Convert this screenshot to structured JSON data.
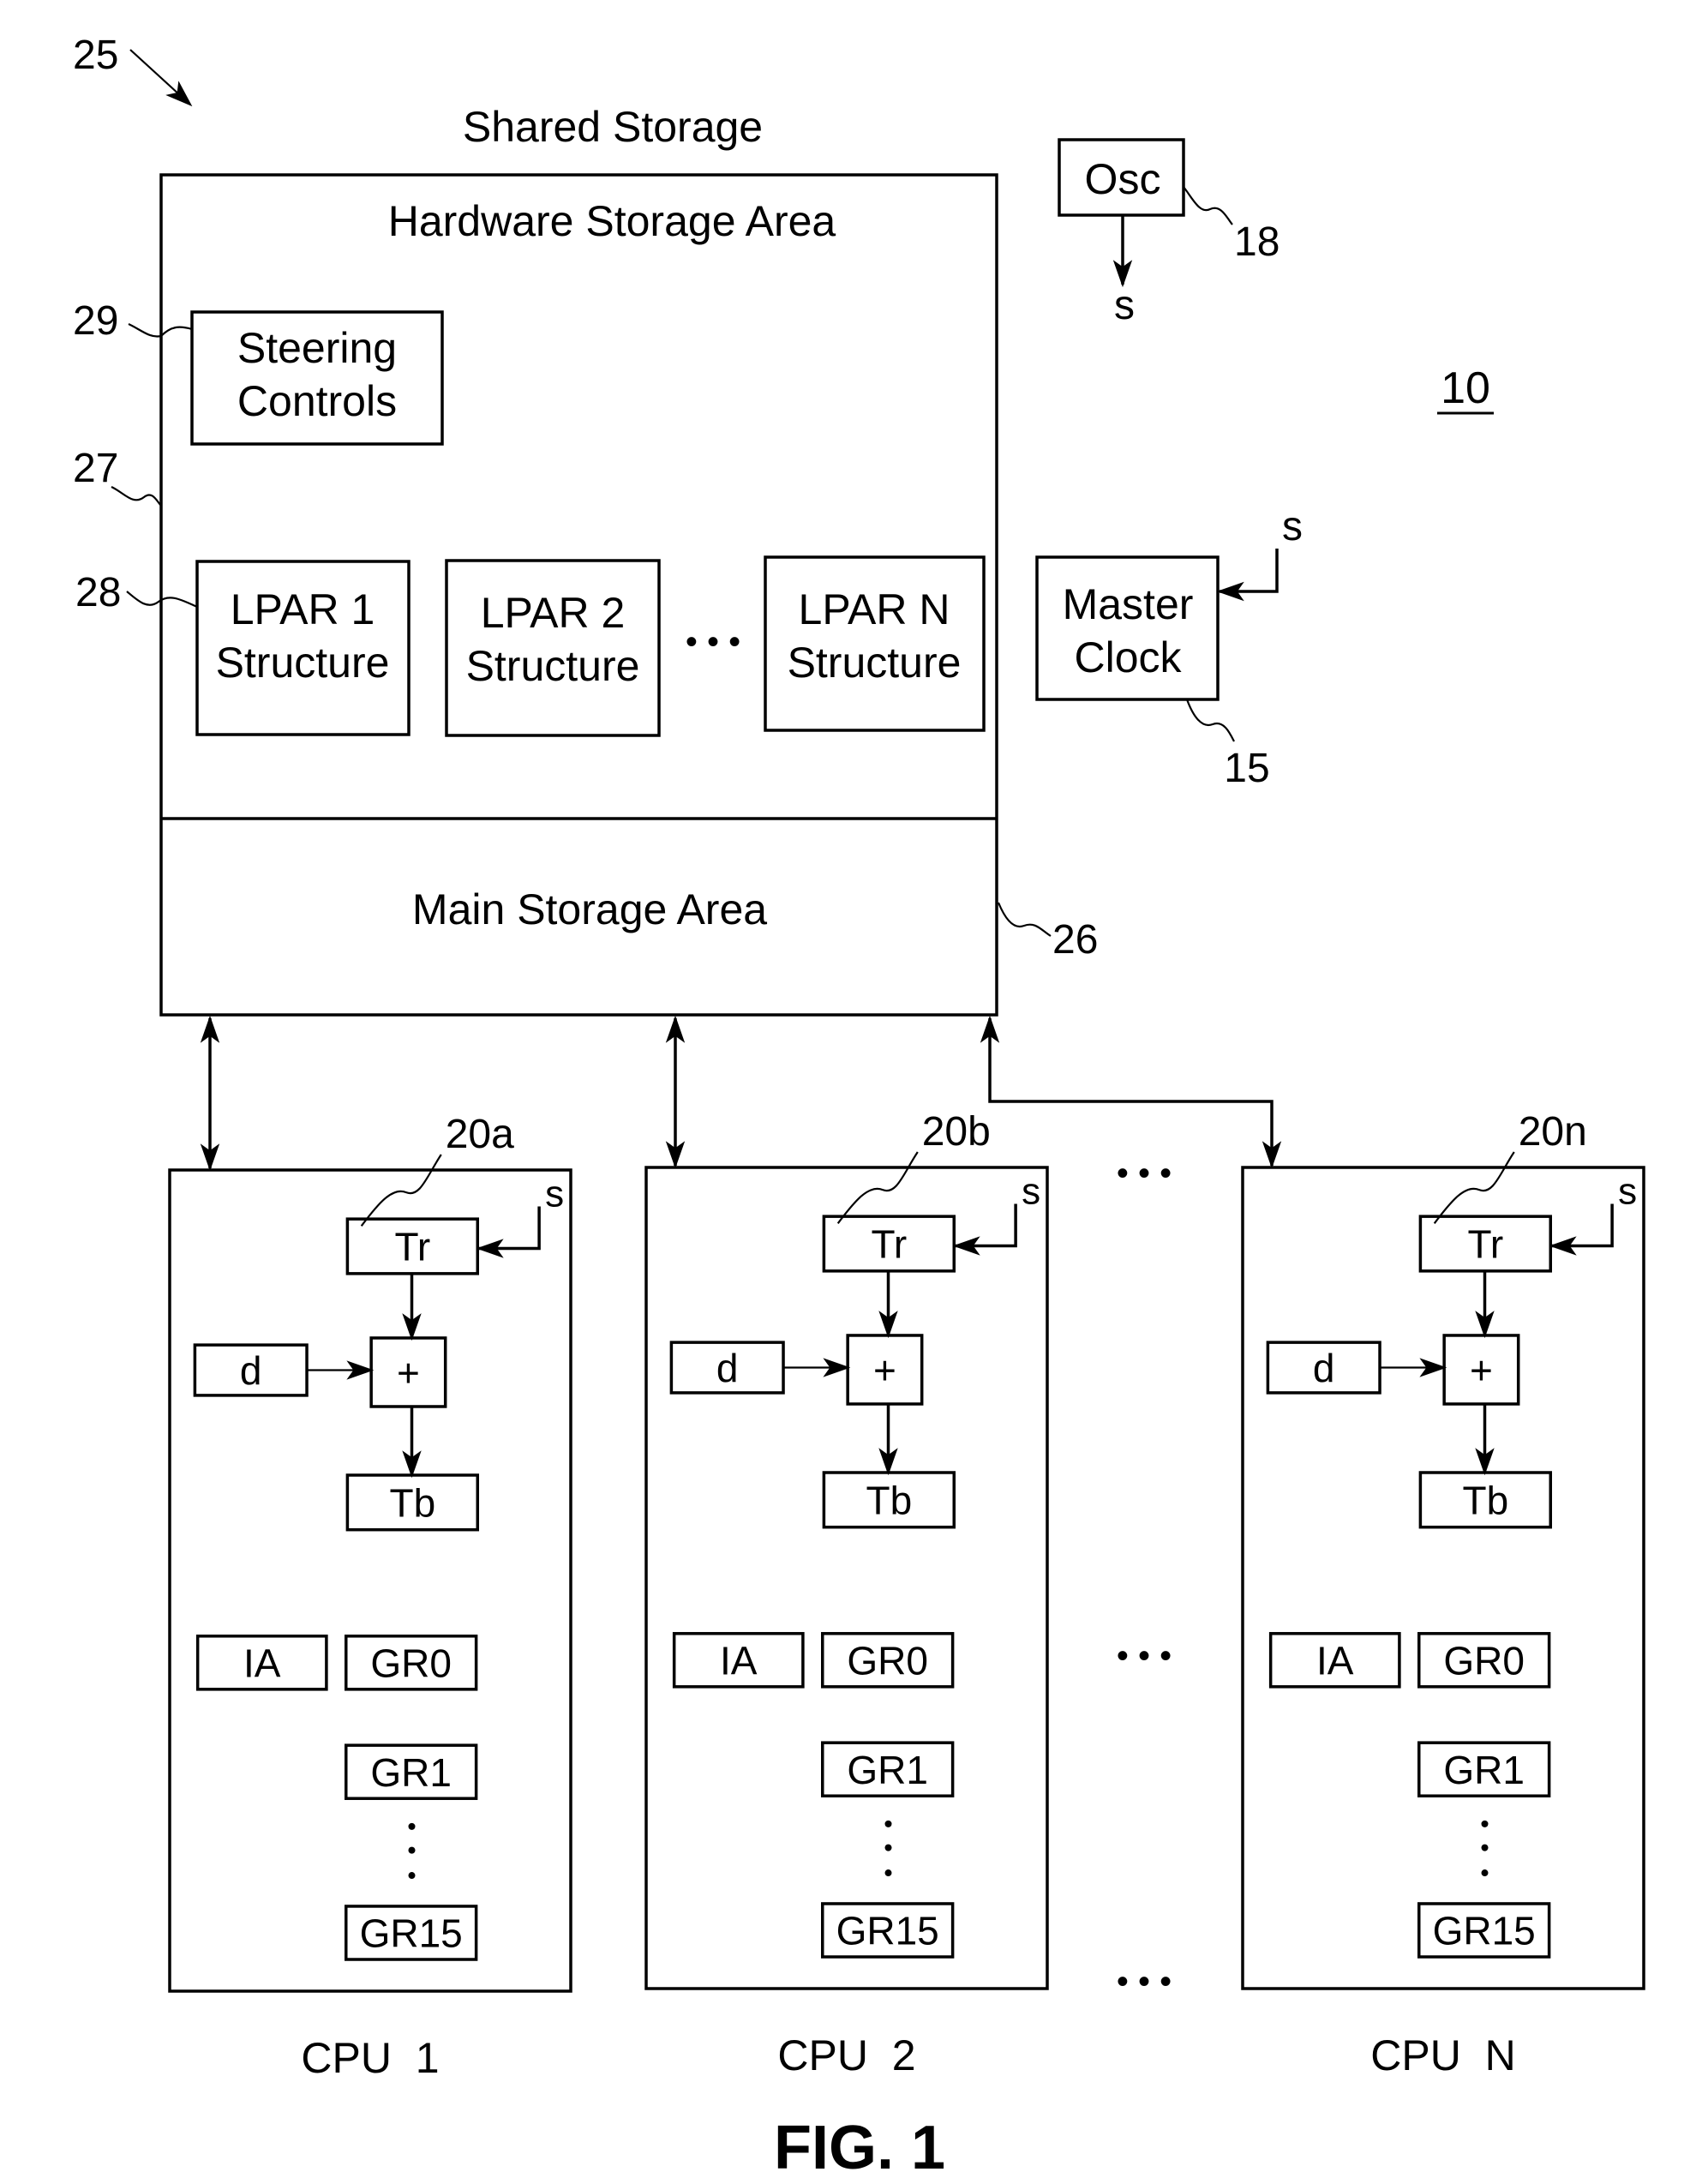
{
  "figure": {
    "label": "FIG. 1",
    "system_ref": "10",
    "system_ref_25": "25"
  },
  "shared_storage": {
    "title": "Shared Storage",
    "ref_outer": "26",
    "hardware_area": {
      "title": "Hardware Storage Area",
      "ref": "27",
      "steering": {
        "line1": "Steering",
        "line2": "Controls",
        "ref": "29"
      },
      "lpar_ref": "28",
      "lpars": [
        {
          "line1": "LPAR 1",
          "line2": "Structure"
        },
        {
          "line1": "LPAR 2",
          "line2": "Structure"
        },
        {
          "line1": "LPAR N",
          "line2": "Structure"
        }
      ],
      "ellipsis": "• • •"
    },
    "main_area": {
      "title": "Main Storage Area"
    }
  },
  "oscillator": {
    "label": "Osc",
    "ref": "18",
    "signal": "s"
  },
  "master_clock": {
    "line1": "Master",
    "line2": "Clock",
    "ref": "15",
    "signal": "s"
  },
  "cpus": [
    {
      "name": "CPU  1",
      "ref": "20a",
      "signal": "s",
      "tr": "Tr",
      "adder": "+",
      "d": "d",
      "tb": "Tb",
      "ia": "IA",
      "gr0": "GR0",
      "gr1": "GR1",
      "gr15": "GR15"
    },
    {
      "name": "CPU  2",
      "ref": "20b",
      "signal": "s",
      "tr": "Tr",
      "adder": "+",
      "d": "d",
      "tb": "Tb",
      "ia": "IA",
      "gr0": "GR0",
      "gr1": "GR1",
      "gr15": "GR15"
    },
    {
      "name": "CPU  N",
      "ref": "20n",
      "signal": "s",
      "tr": "Tr",
      "adder": "+",
      "d": "d",
      "tb": "Tb",
      "ia": "IA",
      "gr0": "GR0",
      "gr1": "GR1",
      "gr15": "GR15"
    }
  ],
  "ellipses": {
    "cpu_top": "• • •",
    "cpu_mid": "• • •",
    "cpu_bottom": "• • •"
  }
}
